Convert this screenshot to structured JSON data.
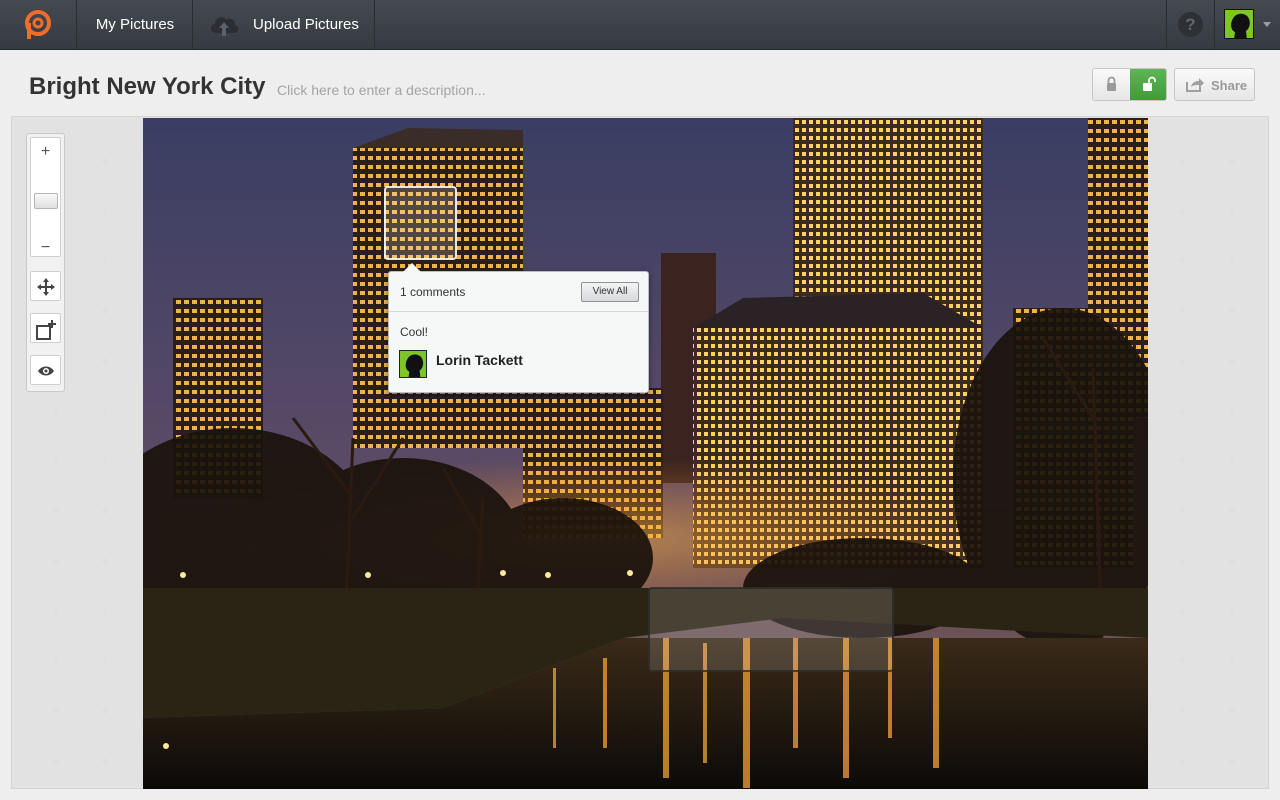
{
  "nav": {
    "my_pictures": "My Pictures",
    "upload_pictures": "Upload Pictures",
    "help": "?"
  },
  "picture": {
    "title": "Bright New York City",
    "description_placeholder": "Click here to enter a description..."
  },
  "actions": {
    "share": "Share"
  },
  "zoom": {
    "zoom_in": "+",
    "zoom_out": "−"
  },
  "comment_popup": {
    "count_label": "1 comments",
    "view_all": "View All",
    "comment_text": "Cool!",
    "author": "Lorin Tackett"
  },
  "colors": {
    "brand_orange": "#f26c2b",
    "topbar": "#3d4248",
    "unlock_green": "#4aa742",
    "avatar_green": "#7ec626"
  }
}
